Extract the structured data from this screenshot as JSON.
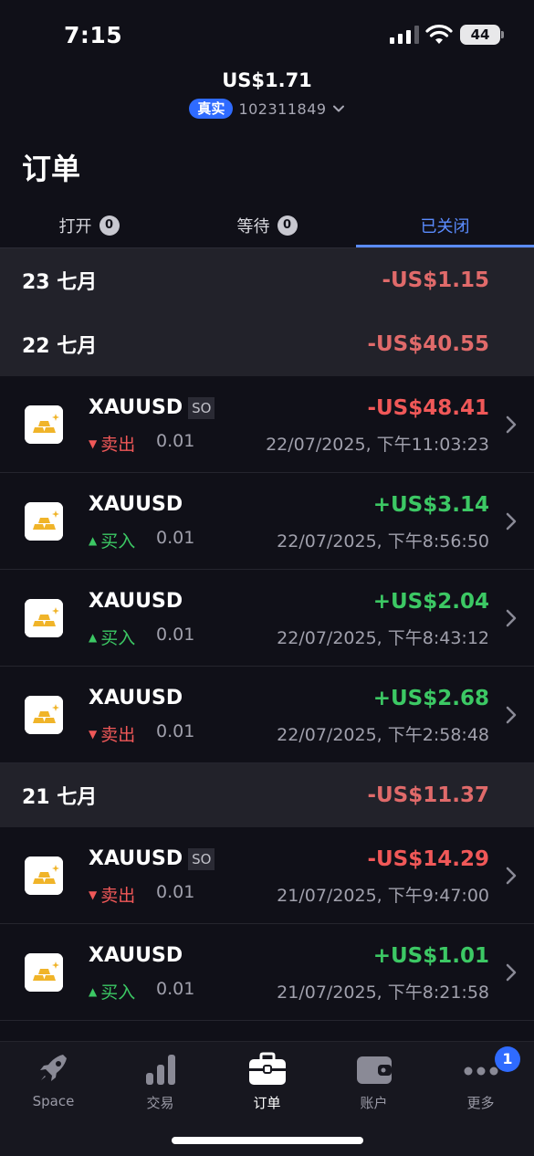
{
  "status_bar": {
    "time": "7:15",
    "battery": "44"
  },
  "header": {
    "balance": "US$1.71",
    "account_type": "真实",
    "account_number": "102311849"
  },
  "page_title": "订单",
  "tabs": [
    {
      "label": "打开",
      "count": "0"
    },
    {
      "label": "等待",
      "count": "0"
    },
    {
      "label": "已关闭"
    }
  ],
  "groups": [
    {
      "date": "23 七月",
      "total": "-US$1.15",
      "orders": []
    },
    {
      "date": "22 七月",
      "total": "-US$40.55",
      "orders": [
        {
          "symbol": "XAUUSD",
          "tag": "SO",
          "side": "卖出",
          "qty": "0.01",
          "pnl": "-US$48.41",
          "datetime": "22/07/2025, 下午11:03:23"
        },
        {
          "symbol": "XAUUSD",
          "tag": "",
          "side": "买入",
          "qty": "0.01",
          "pnl": "+US$3.14",
          "datetime": "22/07/2025, 下午8:56:50"
        },
        {
          "symbol": "XAUUSD",
          "tag": "",
          "side": "买入",
          "qty": "0.01",
          "pnl": "+US$2.04",
          "datetime": "22/07/2025, 下午8:43:12"
        },
        {
          "symbol": "XAUUSD",
          "tag": "",
          "side": "卖出",
          "qty": "0.01",
          "pnl": "+US$2.68",
          "datetime": "22/07/2025, 下午2:58:48"
        }
      ]
    },
    {
      "date": "21 七月",
      "total": "-US$11.37",
      "orders": [
        {
          "symbol": "XAUUSD",
          "tag": "SO",
          "side": "卖出",
          "qty": "0.01",
          "pnl": "-US$14.29",
          "datetime": "21/07/2025, 下午9:47:00"
        },
        {
          "symbol": "XAUUSD",
          "tag": "",
          "side": "买入",
          "qty": "0.01",
          "pnl": "+US$1.01",
          "datetime": "21/07/2025, 下午8:21:58"
        }
      ]
    }
  ],
  "tabbar": [
    {
      "label": "Space",
      "icon": "rocket-icon"
    },
    {
      "label": "交易",
      "icon": "bar-chart-icon"
    },
    {
      "label": "订单",
      "icon": "briefcase-icon"
    },
    {
      "label": "账户",
      "icon": "wallet-icon"
    },
    {
      "label": "更多",
      "icon": "more-icon"
    }
  ],
  "more_badge": "1",
  "colors": {
    "accent": "#5b8cff",
    "badge": "#2f6bff",
    "loss": "#f05858",
    "profit": "#3cc864"
  }
}
